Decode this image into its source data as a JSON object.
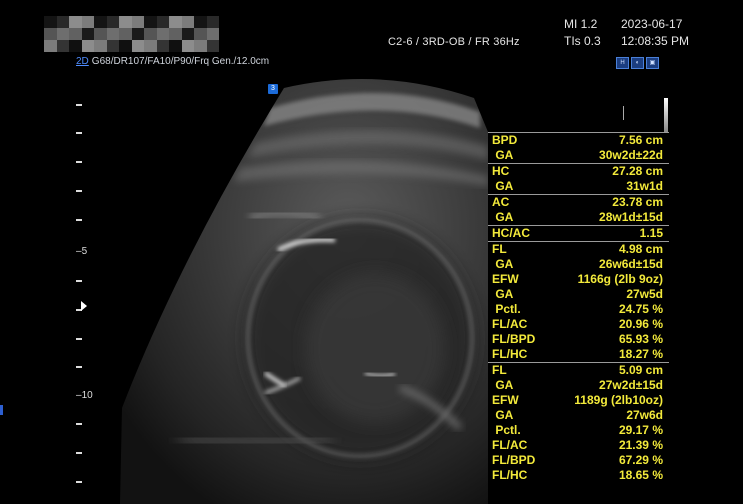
{
  "header": {
    "probe_info": "C2-6 / 3RD-OB / FR 36Hz",
    "mi": "MI  1.2",
    "tis": "TIs 0.3",
    "date": "2023-06-17",
    "time": "12:08:35 PM"
  },
  "mode": {
    "label": "2D",
    "params": "G68/DR107/FA10/P90/Frq Gen./12.0cm"
  },
  "focus_marker": "3",
  "depth_scale": {
    "labels": [
      "5",
      "10"
    ]
  },
  "measurements": [
    {
      "label": "BPD",
      "value": "7.56 cm",
      "sep": true
    },
    {
      "label": " GA",
      "value": "30w2d±22d",
      "sep": false
    },
    {
      "label": "HC",
      "value": "27.28 cm",
      "sep": true
    },
    {
      "label": " GA",
      "value": "31w1d",
      "sep": false
    },
    {
      "label": "AC",
      "value": "23.78 cm",
      "sep": true
    },
    {
      "label": " GA",
      "value": "28w1d±15d",
      "sep": false
    },
    {
      "label": "HC/AC",
      "value": "1.15",
      "sep": true
    },
    {
      "label": "FL",
      "value": "4.98 cm",
      "sep": true
    },
    {
      "label": " GA",
      "value": "26w6d±15d",
      "sep": false
    },
    {
      "label": "EFW",
      "value": "1166g (2lb 9oz)",
      "sep": false
    },
    {
      "label": " GA",
      "value": "27w5d",
      "sep": false
    },
    {
      "label": " Pctl.",
      "value": "24.75 %",
      "sep": false
    },
    {
      "label": "FL/AC",
      "value": "20.96 %",
      "sep": false
    },
    {
      "label": "FL/BPD",
      "value": "65.93 %",
      "sep": false
    },
    {
      "label": "FL/HC",
      "value": "18.27 %",
      "sep": false
    },
    {
      "label": "FL",
      "value": "5.09 cm",
      "sep": true
    },
    {
      "label": " GA",
      "value": "27w2d±15d",
      "sep": false
    },
    {
      "label": "EFW",
      "value": "1189g (2lb10oz)",
      "sep": false
    },
    {
      "label": " GA",
      "value": "27w6d",
      "sep": false
    },
    {
      "label": " Pctl.",
      "value": "29.17 %",
      "sep": false
    },
    {
      "label": "FL/AC",
      "value": "21.39 %",
      "sep": false
    },
    {
      "label": "FL/BPD",
      "value": "67.29 %",
      "sep": false
    },
    {
      "label": "FL/HC",
      "value": "18.65 %",
      "sep": false
    }
  ],
  "colors": {
    "measurement_text": "#f3ea3b",
    "accent_blue": "#4f8cff"
  },
  "icons": [
    "pixelated-patient-name",
    "tool-icon-1",
    "tool-icon-2",
    "tool-icon-3",
    "focus-arrow-icon",
    "grayscale-bar"
  ]
}
